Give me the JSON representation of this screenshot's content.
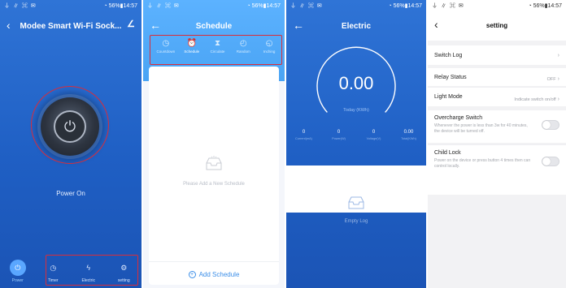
{
  "status": {
    "left_icons": "⏚ ∥ ⌘ ✉",
    "battery": "◔ 56%▮14:57"
  },
  "panel1": {
    "title": "Modee Smart Wi-Fi Sock...",
    "back_icon": "chevron-left-icon",
    "edit_icon": "edit-icon",
    "power_state": "Power On",
    "tabs": [
      {
        "label": "Power",
        "icon": "power-icon",
        "glyph": "⏻"
      },
      {
        "label": "Timer",
        "icon": "timer-icon",
        "glyph": "◷"
      },
      {
        "label": "Electric",
        "icon": "bolt-icon",
        "glyph": "ϟ"
      },
      {
        "label": "setting",
        "icon": "gear-icon",
        "glyph": "⚙"
      }
    ]
  },
  "panel2": {
    "title": "Schedule",
    "tabs": [
      {
        "label": "Countdown",
        "glyph": "◷"
      },
      {
        "label": "Schedule",
        "glyph": "⏰"
      },
      {
        "label": "Circulate",
        "glyph": "⧗"
      },
      {
        "label": "Random",
        "glyph": "◴"
      },
      {
        "label": "Inching",
        "glyph": "◵"
      }
    ],
    "empty_text": "Please Add a New Schedule",
    "add_label": "Add Schedule"
  },
  "panel3": {
    "title": "Electric",
    "value": "0.00",
    "unit": "Today (KWh)",
    "stats": [
      {
        "value": "0",
        "label": "Current(mA)"
      },
      {
        "value": "0",
        "label": "Power(W)"
      },
      {
        "value": "0",
        "label": "Voltage(V)"
      },
      {
        "value": "0.00",
        "label": "Total(KWh)"
      }
    ],
    "empty_text": "Empty Log"
  },
  "panel4": {
    "title": "setting",
    "switch_log": "Switch Log",
    "relay_status_label": "Relay Status",
    "relay_status_value": "OFF",
    "light_mode_label": "Light Mode",
    "light_mode_value": "Indicate switch on/off",
    "overcharge_label": "Overcharge Switch",
    "overcharge_desc": "Whenever the power is less than 3w for 40 minutes, the device will be turned off.",
    "child_lock_label": "Child Lock",
    "child_lock_desc": "Power on the device or press button 4 times then can control locally."
  },
  "colors": {
    "primary_blue": "#1f5fc4",
    "light_blue": "#4aa4f4",
    "highlight_red": "#d92d3a"
  }
}
